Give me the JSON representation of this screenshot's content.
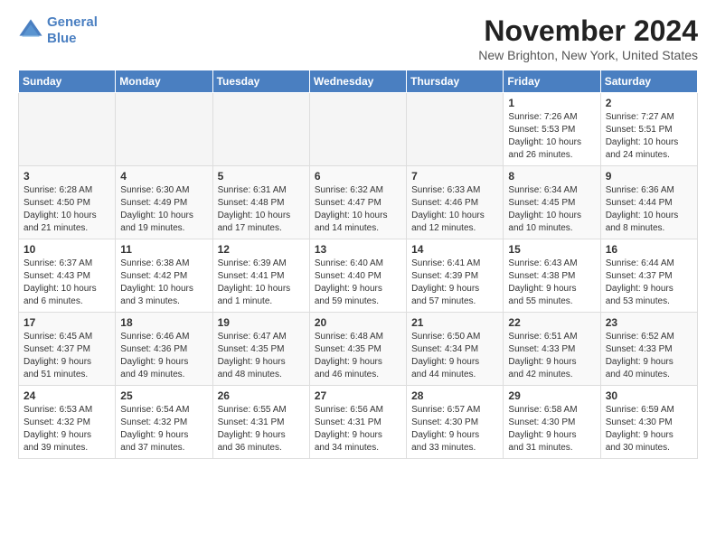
{
  "logo": {
    "line1": "General",
    "line2": "Blue"
  },
  "title": "November 2024",
  "location": "New Brighton, New York, United States",
  "days_of_week": [
    "Sunday",
    "Monday",
    "Tuesday",
    "Wednesday",
    "Thursday",
    "Friday",
    "Saturday"
  ],
  "weeks": [
    [
      {
        "day": "",
        "info": "",
        "empty": true
      },
      {
        "day": "",
        "info": "",
        "empty": true
      },
      {
        "day": "",
        "info": "",
        "empty": true
      },
      {
        "day": "",
        "info": "",
        "empty": true
      },
      {
        "day": "",
        "info": "",
        "empty": true
      },
      {
        "day": "1",
        "info": "Sunrise: 7:26 AM\nSunset: 5:53 PM\nDaylight: 10 hours\nand 26 minutes."
      },
      {
        "day": "2",
        "info": "Sunrise: 7:27 AM\nSunset: 5:51 PM\nDaylight: 10 hours\nand 24 minutes."
      }
    ],
    [
      {
        "day": "3",
        "info": "Sunrise: 6:28 AM\nSunset: 4:50 PM\nDaylight: 10 hours\nand 21 minutes."
      },
      {
        "day": "4",
        "info": "Sunrise: 6:30 AM\nSunset: 4:49 PM\nDaylight: 10 hours\nand 19 minutes."
      },
      {
        "day": "5",
        "info": "Sunrise: 6:31 AM\nSunset: 4:48 PM\nDaylight: 10 hours\nand 17 minutes."
      },
      {
        "day": "6",
        "info": "Sunrise: 6:32 AM\nSunset: 4:47 PM\nDaylight: 10 hours\nand 14 minutes."
      },
      {
        "day": "7",
        "info": "Sunrise: 6:33 AM\nSunset: 4:46 PM\nDaylight: 10 hours\nand 12 minutes."
      },
      {
        "day": "8",
        "info": "Sunrise: 6:34 AM\nSunset: 4:45 PM\nDaylight: 10 hours\nand 10 minutes."
      },
      {
        "day": "9",
        "info": "Sunrise: 6:36 AM\nSunset: 4:44 PM\nDaylight: 10 hours\nand 8 minutes."
      }
    ],
    [
      {
        "day": "10",
        "info": "Sunrise: 6:37 AM\nSunset: 4:43 PM\nDaylight: 10 hours\nand 6 minutes."
      },
      {
        "day": "11",
        "info": "Sunrise: 6:38 AM\nSunset: 4:42 PM\nDaylight: 10 hours\nand 3 minutes."
      },
      {
        "day": "12",
        "info": "Sunrise: 6:39 AM\nSunset: 4:41 PM\nDaylight: 10 hours\nand 1 minute."
      },
      {
        "day": "13",
        "info": "Sunrise: 6:40 AM\nSunset: 4:40 PM\nDaylight: 9 hours\nand 59 minutes."
      },
      {
        "day": "14",
        "info": "Sunrise: 6:41 AM\nSunset: 4:39 PM\nDaylight: 9 hours\nand 57 minutes."
      },
      {
        "day": "15",
        "info": "Sunrise: 6:43 AM\nSunset: 4:38 PM\nDaylight: 9 hours\nand 55 minutes."
      },
      {
        "day": "16",
        "info": "Sunrise: 6:44 AM\nSunset: 4:37 PM\nDaylight: 9 hours\nand 53 minutes."
      }
    ],
    [
      {
        "day": "17",
        "info": "Sunrise: 6:45 AM\nSunset: 4:37 PM\nDaylight: 9 hours\nand 51 minutes."
      },
      {
        "day": "18",
        "info": "Sunrise: 6:46 AM\nSunset: 4:36 PM\nDaylight: 9 hours\nand 49 minutes."
      },
      {
        "day": "19",
        "info": "Sunrise: 6:47 AM\nSunset: 4:35 PM\nDaylight: 9 hours\nand 48 minutes."
      },
      {
        "day": "20",
        "info": "Sunrise: 6:48 AM\nSunset: 4:35 PM\nDaylight: 9 hours\nand 46 minutes."
      },
      {
        "day": "21",
        "info": "Sunrise: 6:50 AM\nSunset: 4:34 PM\nDaylight: 9 hours\nand 44 minutes."
      },
      {
        "day": "22",
        "info": "Sunrise: 6:51 AM\nSunset: 4:33 PM\nDaylight: 9 hours\nand 42 minutes."
      },
      {
        "day": "23",
        "info": "Sunrise: 6:52 AM\nSunset: 4:33 PM\nDaylight: 9 hours\nand 40 minutes."
      }
    ],
    [
      {
        "day": "24",
        "info": "Sunrise: 6:53 AM\nSunset: 4:32 PM\nDaylight: 9 hours\nand 39 minutes."
      },
      {
        "day": "25",
        "info": "Sunrise: 6:54 AM\nSunset: 4:32 PM\nDaylight: 9 hours\nand 37 minutes."
      },
      {
        "day": "26",
        "info": "Sunrise: 6:55 AM\nSunset: 4:31 PM\nDaylight: 9 hours\nand 36 minutes."
      },
      {
        "day": "27",
        "info": "Sunrise: 6:56 AM\nSunset: 4:31 PM\nDaylight: 9 hours\nand 34 minutes."
      },
      {
        "day": "28",
        "info": "Sunrise: 6:57 AM\nSunset: 4:30 PM\nDaylight: 9 hours\nand 33 minutes."
      },
      {
        "day": "29",
        "info": "Sunrise: 6:58 AM\nSunset: 4:30 PM\nDaylight: 9 hours\nand 31 minutes."
      },
      {
        "day": "30",
        "info": "Sunrise: 6:59 AM\nSunset: 4:30 PM\nDaylight: 9 hours\nand 30 minutes."
      }
    ]
  ]
}
